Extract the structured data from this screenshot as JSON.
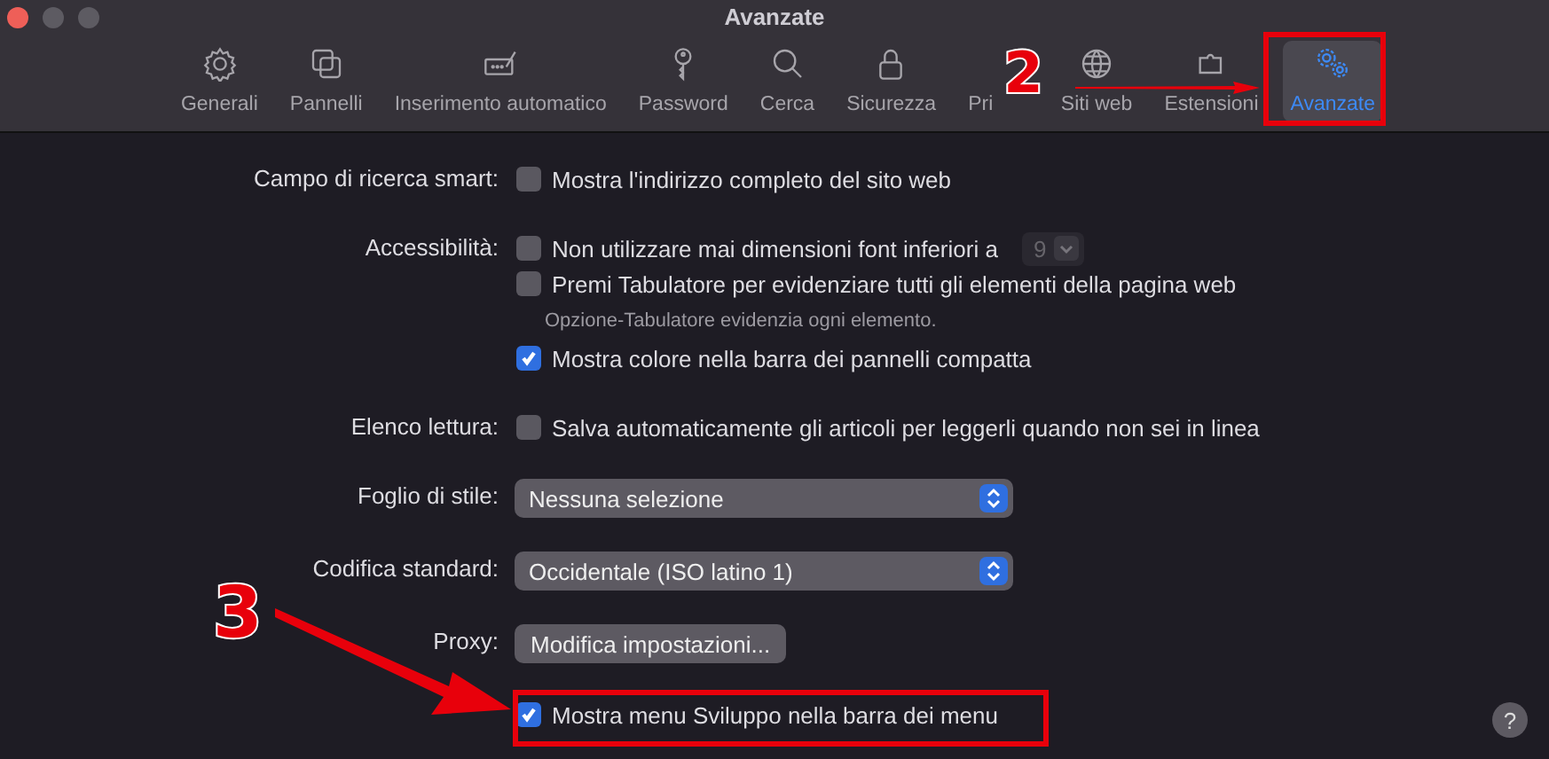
{
  "window": {
    "title": "Avanzate"
  },
  "toolbar": [
    {
      "label": "Generali",
      "selected": false
    },
    {
      "label": "Pannelli",
      "selected": false
    },
    {
      "label": "Inserimento automatico",
      "selected": false
    },
    {
      "label": "Password",
      "selected": false
    },
    {
      "label": "Cerca",
      "selected": false
    },
    {
      "label": "Sicurezza",
      "selected": false
    },
    {
      "label": "Pri",
      "selected": false
    },
    {
      "label": "Siti web",
      "selected": false
    },
    {
      "label": "Estensioni",
      "selected": false
    },
    {
      "label": "Avanzate",
      "selected": true
    }
  ],
  "sections": [
    {
      "label": "Campo di ricerca smart:",
      "items": [
        {
          "kind": "checkbox",
          "text": "Mostra l'indirizzo completo del sito web",
          "checked": false
        }
      ]
    },
    {
      "label": "Accessibilità:",
      "items": [
        {
          "kind": "checkbox",
          "text": "Non utilizzare mai dimensioni font inferiori a",
          "checked": false,
          "size_value": "9"
        },
        {
          "kind": "checkbox",
          "text": "Premi Tabulatore per evidenziare tutti gli elementi della pagina web",
          "checked": false
        },
        {
          "kind": "note",
          "text": "Opzione-Tabulatore evidenzia ogni elemento."
        },
        {
          "kind": "checkbox",
          "text": "Mostra colore nella barra dei pannelli compatta",
          "checked": true
        }
      ]
    },
    {
      "label": "Elenco lettura:",
      "items": [
        {
          "kind": "checkbox",
          "text": "Salva automaticamente gli articoli per leggerli quando non sei in linea",
          "checked": false
        }
      ]
    },
    {
      "label": "Foglio di stile:",
      "items": [
        {
          "kind": "select",
          "text": "Nessuna selezione"
        }
      ]
    },
    {
      "label": "Codifica standard:",
      "items": [
        {
          "kind": "select",
          "text": "Occidentale (ISO latino 1)"
        }
      ]
    },
    {
      "label": "Proxy:",
      "items": [
        {
          "kind": "button",
          "text": "Modifica impostazioni..."
        }
      ]
    },
    {
      "items": [
        {
          "kind": "checkbox",
          "text": "Mostra menu Sviluppo nella barra dei menu",
          "checked": true
        }
      ]
    }
  ],
  "help_button": "?",
  "annotations": [
    {
      "label": "2"
    },
    {
      "label": "3"
    }
  ]
}
